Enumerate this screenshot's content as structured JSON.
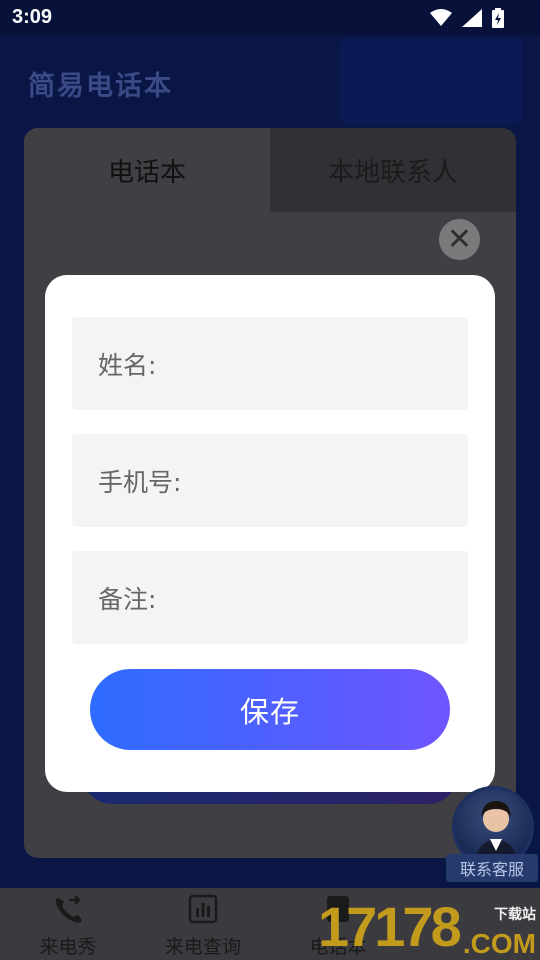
{
  "status_bar": {
    "time": "3:09"
  },
  "app": {
    "title": "简易电话本"
  },
  "tabs": [
    {
      "label": "电话本"
    },
    {
      "label": "本地联系人"
    }
  ],
  "modal": {
    "fields": [
      {
        "label": "姓名:"
      },
      {
        "label": "手机号:"
      },
      {
        "label": "备注:"
      }
    ],
    "save_label": "保存"
  },
  "support": {
    "label": "联系客服"
  },
  "bottom_nav": [
    {
      "label": "来电秀",
      "icon": "phone-transfer-icon"
    },
    {
      "label": "来电查询",
      "icon": "chart-icon"
    },
    {
      "label": "电话本",
      "icon": "contacts-icon"
    }
  ],
  "watermark": {
    "number": "17178",
    "domain": ".COM",
    "text": "下载站"
  },
  "colors": {
    "accent_start": "#2d6bff",
    "accent_end": "#6f55ff",
    "modal_bg": "#ffffff"
  }
}
